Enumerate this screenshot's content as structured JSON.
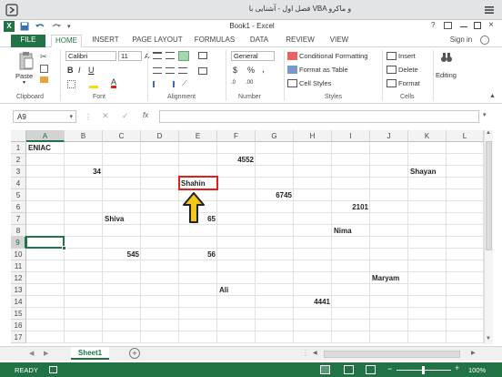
{
  "top_bar": {
    "title": "فصل اول - آشنایی با VBA و ماکرو",
    "left_icon": "rtl-navigation-icon",
    "right_icon": "menu-icon"
  },
  "window": {
    "title": "Book1 - Excel",
    "qat": [
      "save-icon",
      "undo-icon",
      "redo-icon"
    ]
  },
  "tabs": {
    "file": "FILE",
    "home": "HOME",
    "insert": "INSERT",
    "page_layout": "PAGE LAYOUT",
    "formulas": "FORMULAS",
    "data": "DATA",
    "review": "REVIEW",
    "view": "VIEW",
    "sign_in": "Sign in"
  },
  "ribbon": {
    "clipboard": {
      "label": "Clipboard",
      "paste": "Paste"
    },
    "font": {
      "label": "Font",
      "name": "Calibri",
      "size": "11",
      "bold": "B",
      "italic": "I",
      "underline": "U"
    },
    "alignment": {
      "label": "Alignment"
    },
    "number": {
      "label": "Number",
      "format": "General",
      "currency": "$",
      "percent": "%"
    },
    "styles": {
      "label": "Styles",
      "conditional": "Conditional Formatting",
      "table": "Format as Table",
      "cell": "Cell Styles"
    },
    "cells": {
      "label": "Cells",
      "insert": "Insert",
      "delete": "Delete",
      "format": "Format"
    },
    "editing": {
      "label": "Editing"
    }
  },
  "formula_bar": {
    "name_box": "A9",
    "fx": "fx",
    "value": ""
  },
  "columns": [
    "A",
    "B",
    "C",
    "D",
    "E",
    "F",
    "G",
    "H",
    "I",
    "J",
    "K",
    "L"
  ],
  "rows": [
    "1",
    "2",
    "3",
    "4",
    "5",
    "6",
    "7",
    "8",
    "9",
    "10",
    "11",
    "12",
    "13",
    "14",
    "15",
    "16",
    "17"
  ],
  "cells": {
    "A1": "ENIAC",
    "F2": "4552",
    "B3": "34",
    "K3": "Shayan",
    "E4": "Shahin",
    "G5": "6745",
    "I6": "2101",
    "C7": "Shiva",
    "E7": "65",
    "I8": "Nima",
    "C10": "545",
    "E10": "56",
    "J12": "Maryam",
    "F13": "Ali",
    "H14": "4441"
  },
  "selected_cell": "A9",
  "highlighted_cell": "E4",
  "sheet": {
    "tab": "Sheet1",
    "add": "+"
  },
  "status": {
    "ready": "READY",
    "zoom": "100%",
    "zoom_level_percent": 100
  },
  "colors": {
    "excel_green": "#217346",
    "highlight_red": "#e0201b",
    "arrow_yellow": "#f5c518"
  }
}
